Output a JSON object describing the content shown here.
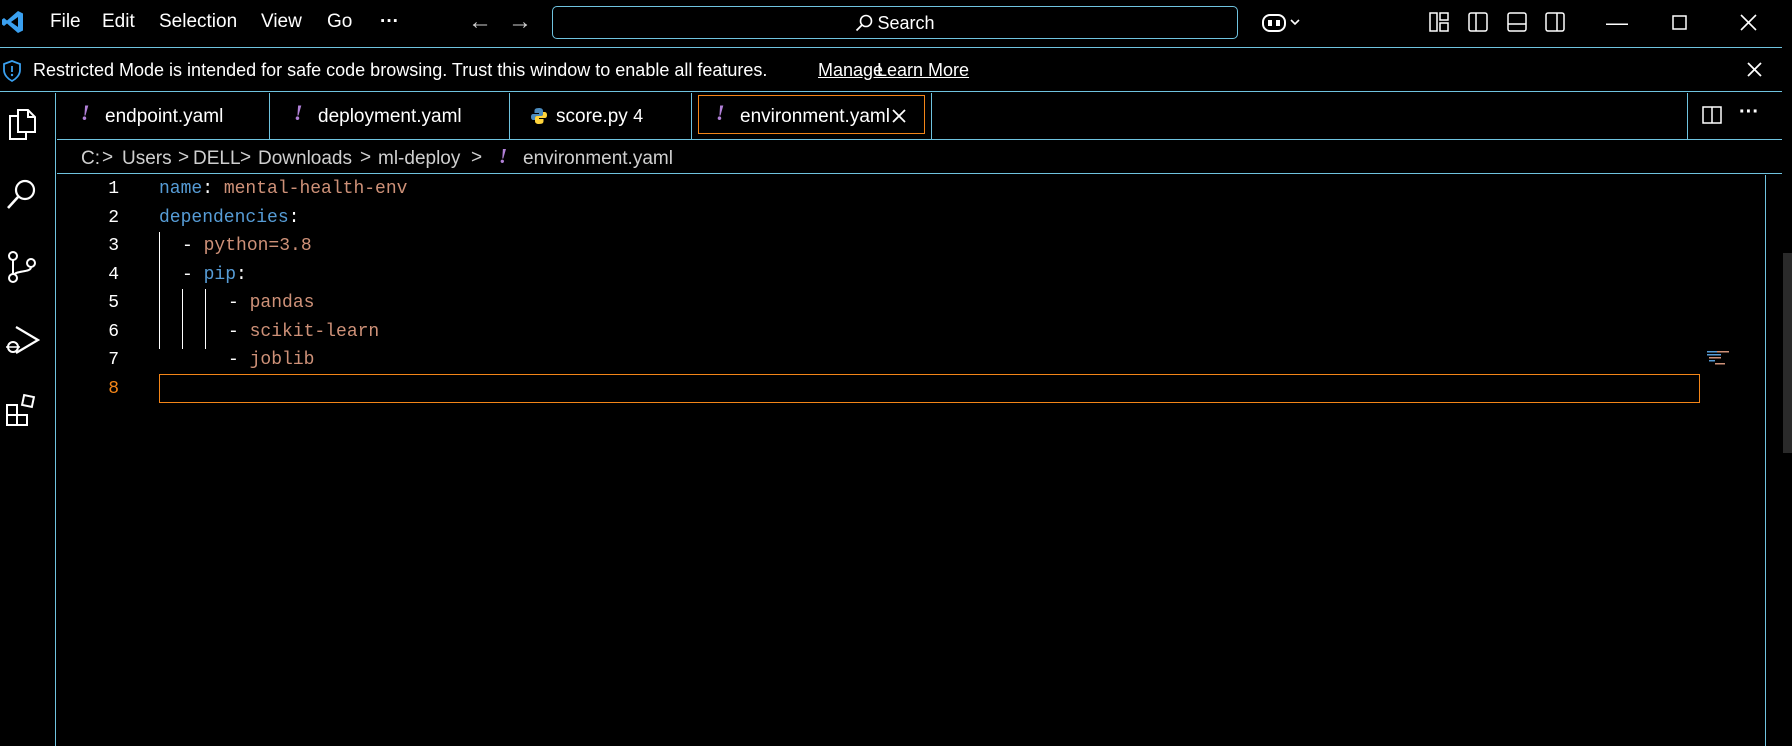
{
  "titlebar": {
    "menu": [
      "File",
      "Edit",
      "Selection",
      "View",
      "Go",
      "···"
    ],
    "back_icon": "arrow-left-icon",
    "forward_icon": "arrow-right-icon",
    "search_label": "Search",
    "copilot_icon": "copilot-icon",
    "layout_icons": [
      "customize-layout-icon",
      "toggle-primary-sidebar-icon",
      "toggle-panel-icon",
      "toggle-secondary-sidebar-icon"
    ],
    "window_controls": [
      "minimize-icon",
      "maximize-icon",
      "close-icon"
    ]
  },
  "banner": {
    "text": "Restricted Mode is intended for safe code browsing. Trust this window to enable all features.",
    "manage": "Manage",
    "learn_more": "Learn More"
  },
  "activitybar": [
    "explorer-icon",
    "search-icon",
    "source-control-icon",
    "run-debug-icon",
    "extensions-icon"
  ],
  "tabs": [
    {
      "label": "endpoint.yaml",
      "icon": "yaml-icon"
    },
    {
      "label": "deployment.yaml",
      "icon": "yaml-icon"
    },
    {
      "label": "score.py",
      "icon": "python-icon",
      "badge": "4"
    },
    {
      "label": "environment.yaml",
      "icon": "yaml-icon",
      "active": true
    }
  ],
  "breadcrumb": [
    "C:",
    "Users",
    "DELL",
    "Downloads",
    "ml-deploy",
    "environment.yaml"
  ],
  "editor": {
    "line_numbers": [
      "1",
      "2",
      "3",
      "4",
      "5",
      "6",
      "7",
      "8"
    ],
    "current_line": "8",
    "lines": [
      {
        "key": "name",
        "colon": ": ",
        "value": "mental-health-env"
      },
      {
        "key": "dependencies",
        "colon": ":"
      },
      {
        "dash": "- ",
        "value": "python=3.8"
      },
      {
        "dash": "- ",
        "key": "pip",
        "colon": ":"
      },
      {
        "dash": "- ",
        "value": "pandas"
      },
      {
        "dash": "- ",
        "value": "scikit-learn"
      },
      {
        "dash": "- ",
        "value": "joblib"
      }
    ]
  },
  "colors": {
    "accent_border": "#6fc3df",
    "active_border": "#f38518",
    "key": "#569cd6",
    "string": "#ce9178",
    "yaml_icon": "#b180d7"
  }
}
